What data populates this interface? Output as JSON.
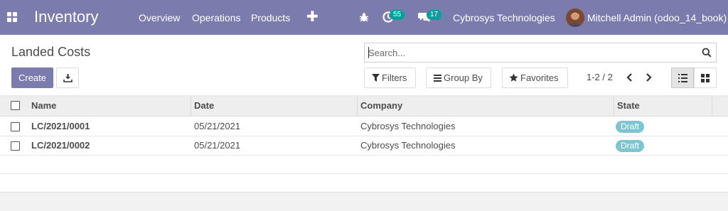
{
  "navbar": {
    "app_name": "Inventory",
    "menu": [
      "Overview",
      "Operations",
      "Products"
    ],
    "add_icon": "plus-icon",
    "bug_icon": "bug-icon",
    "activity_count": "55",
    "messages_count": "17",
    "company": "Cybrosys Technologies",
    "user": "Mitchell Admin (odoo_14_book)",
    "bar_color": "#7c7bad",
    "badge_color": "#00a09d"
  },
  "control_panel": {
    "title": "Landed Costs",
    "search_placeholder": "Search...",
    "create_label": "Create",
    "filters_label": "Filters",
    "group_by_label": "Group By",
    "favorites_label": "Favorites",
    "pager": "1-2 / 2",
    "active_view": "list"
  },
  "table": {
    "columns": [
      "Name",
      "Date",
      "Company",
      "State"
    ],
    "rows": [
      {
        "name": "LC/2021/0001",
        "date": "05/21/2021",
        "company": "Cybrosys Technologies",
        "state": "Draft"
      },
      {
        "name": "LC/2021/0002",
        "date": "05/21/2021",
        "company": "Cybrosys Technologies",
        "state": "Draft"
      }
    ],
    "state_badge_color": "#7dc5d1"
  }
}
